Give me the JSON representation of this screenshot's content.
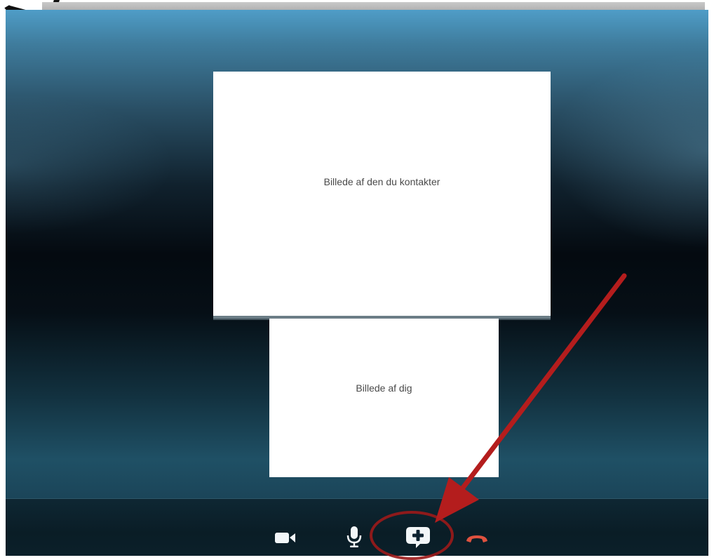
{
  "call": {
    "remote_video_label": "Billede af den du kontakter",
    "self_video_label": "Billede af dig"
  },
  "controls": {
    "video_icon": "video-camera-icon",
    "mic_icon": "microphone-icon",
    "add_icon": "add-chat-icon",
    "hangup_icon": "hang-up-icon"
  },
  "colors": {
    "annotation_red": "#b41d1d",
    "hangup_red": "#e0523f",
    "icon_white": "#f2f6f8"
  }
}
